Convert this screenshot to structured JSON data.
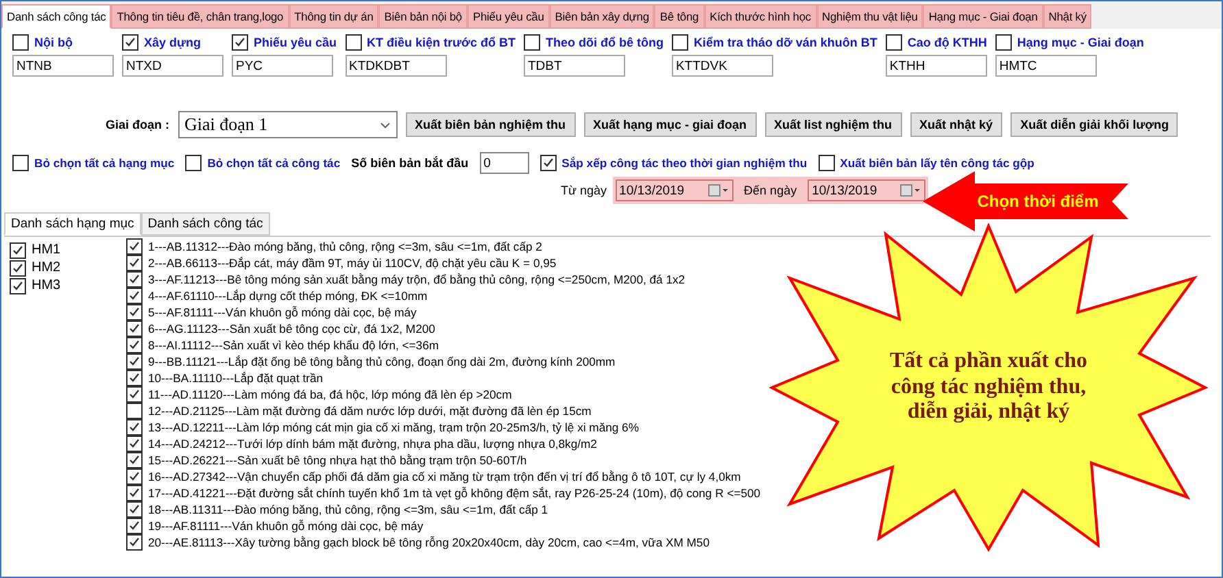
{
  "tabs": [
    {
      "label": "Danh sách công tác",
      "selected": true
    },
    {
      "label": "Thông tin tiêu đề, chân trang,logo",
      "selected": false
    },
    {
      "label": "Thông tin dự án",
      "selected": false
    },
    {
      "label": "Biên bản nội bộ",
      "selected": false
    },
    {
      "label": "Phiếu yêu cầu",
      "selected": false
    },
    {
      "label": "Biên bản xây dựng",
      "selected": false
    },
    {
      "label": "Bê tông",
      "selected": false
    },
    {
      "label": "Kích thước hình học",
      "selected": false
    },
    {
      "label": "Nghiệm thu vật liệu",
      "selected": false
    },
    {
      "label": "Hạng mục - Giai đoạn",
      "selected": false
    },
    {
      "label": "Nhật ký",
      "selected": false
    }
  ],
  "form_types": [
    {
      "label": "Nội bộ",
      "checked": false,
      "code": "NTNB"
    },
    {
      "label": "Xây dựng",
      "checked": true,
      "code": "NTXD"
    },
    {
      "label": "Phiếu yêu cầu",
      "checked": true,
      "code": "PYC"
    },
    {
      "label": "KT điều kiện trước đổ BT",
      "checked": false,
      "code": "KTDKDBT"
    },
    {
      "label": "Theo dõi đổ bê tông",
      "checked": false,
      "code": "TDBT"
    },
    {
      "label": "Kiểm tra tháo dỡ ván khuôn BT",
      "checked": false,
      "code": "KTTDVK"
    },
    {
      "label": "Cao độ KTHH",
      "checked": false,
      "code": "KTHH"
    },
    {
      "label": "Hạng mục - Giai đoạn",
      "checked": false,
      "code": "HMTC"
    }
  ],
  "stage": {
    "label": "Giai đoạn :",
    "value": "Giai đoạn 1"
  },
  "export_buttons": [
    "Xuất biên bản nghiệm thu",
    "Xuất hạng mục - giai đoạn",
    "Xuất list nghiệm thu",
    "Xuất nhật ký",
    "Xuất diễn giải khối lượng"
  ],
  "options": [
    {
      "label": "Bỏ chọn tất cả hạng mục",
      "checked": false
    },
    {
      "label": "Bỏ chọn tất cả công tác",
      "checked": false
    }
  ],
  "start_number": {
    "label": "Số biên bản bắt đầu",
    "value": "0"
  },
  "options2": [
    {
      "label": "Sắp xếp công tác theo thời gian nghiệm thu",
      "checked": true
    },
    {
      "label": "Xuất biên bản lấy tên công tác gộp",
      "checked": false
    }
  ],
  "date_range": {
    "from_label": "Từ ngày",
    "from": "10/13/2019",
    "to_label": "Đến ngày",
    "to": "10/13/2019"
  },
  "arrow_callout": "Chọn thời điểm",
  "inner_tabs": [
    {
      "label": "Danh sách hạng mục",
      "selected": true
    },
    {
      "label": "Danh sách công tác",
      "selected": false
    }
  ],
  "categories": [
    {
      "label": "HM1",
      "checked": true
    },
    {
      "label": "HM2",
      "checked": true
    },
    {
      "label": "HM3",
      "checked": true
    }
  ],
  "tasks": [
    {
      "label": "1---AB.11312---Đào móng băng, thủ công, rộng <=3m, sâu <=1m, đất cấp 2",
      "checked": true
    },
    {
      "label": "2---AB.66113---Đắp cát, máy đầm 9T, máy ủi 110CV, độ chặt yêu cầu K = 0,95",
      "checked": true
    },
    {
      "label": "3---AF.11213---Bê tông móng sản xuất bằng máy trộn, đổ bằng thủ công, rộng <=250cm, M200, đá 1x2",
      "checked": true
    },
    {
      "label": "4---AF.61110---Lắp dựng cốt thép móng, ĐK <=10mm",
      "checked": true
    },
    {
      "label": "5---AF.81111---Ván khuôn gỗ móng dài cọc, bệ máy",
      "checked": true
    },
    {
      "label": "6---AG.11123---Sản xuất bê tông cọc cừ, đá 1x2, M200",
      "checked": true
    },
    {
      "label": "8---AI.11112---Sản xuất vì kèo thép khẩu độ lớn, <=36m",
      "checked": true
    },
    {
      "label": "9---BB.11121---Lắp đặt ống bê tông bằng thủ công, đoạn ống dài 2m, đường kính 200mm",
      "checked": true
    },
    {
      "label": "10---BA.11110---Lắp đặt quạt trần",
      "checked": true
    },
    {
      "label": "11---AD.11120---Làm móng đá ba, đá hộc, lớp móng đã lèn ép >20cm",
      "checked": true
    },
    {
      "label": "12---AD.21125---Làm mặt đường đá dăm nước lớp dưới, mặt đường đã lèn ép 15cm",
      "checked": false
    },
    {
      "label": "13---AD.12211---Làm lớp móng cát mịn gia cố xi măng, trạm trộn 20-25m3/h, tỷ lệ xi măng 6%",
      "checked": true
    },
    {
      "label": "14---AD.24212---Tưới lớp dính bám mặt đường, nhựa pha dầu, lượng nhựa 0,8kg/m2",
      "checked": true
    },
    {
      "label": "15---AD.26221---Sản xuất bê tông nhựa hạt thô bằng trạm trộn 50-60T/h",
      "checked": true
    },
    {
      "label": "16---AD.27342---Vận chuyển cấp phối đá dăm gia cố xi măng từ trạm trộn đến vị trí đổ bằng ô tô 10T, cự ly 4,0km",
      "checked": true
    },
    {
      "label": "17---AD.41221---Đặt đường sắt chính tuyến khổ 1m tà vẹt gỗ không đệm sắt, ray P26-25-24 (10m), độ cong R <=500",
      "checked": true
    },
    {
      "label": "18---AB.11311---Đào móng băng, thủ công, rộng <=3m, sâu <=1m, đất cấp 1",
      "checked": true
    },
    {
      "label": "19---AF.81111---Ván khuôn gỗ móng dài cọc, bệ máy",
      "checked": true
    },
    {
      "label": "20---AE.81113---Xây tường bằng gạch block bê tông rỗng 20x20x40cm, dày 20cm, cao <=4m, vữa XM M50",
      "checked": true
    }
  ],
  "starburst_callout": "Tất cả phần xuất cho công tác nghiệm thu, diễn giải, nhật ký"
}
